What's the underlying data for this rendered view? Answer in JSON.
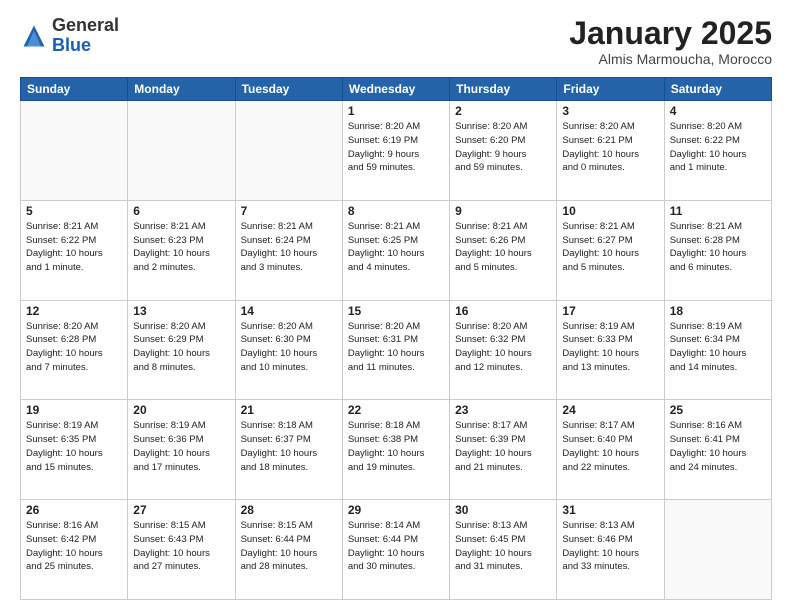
{
  "header": {
    "logo_general": "General",
    "logo_blue": "Blue",
    "month_title": "January 2025",
    "subtitle": "Almis Marmoucha, Morocco"
  },
  "weekdays": [
    "Sunday",
    "Monday",
    "Tuesday",
    "Wednesday",
    "Thursday",
    "Friday",
    "Saturday"
  ],
  "weeks": [
    [
      {
        "day": "",
        "info": "",
        "empty": true
      },
      {
        "day": "",
        "info": "",
        "empty": true
      },
      {
        "day": "",
        "info": "",
        "empty": true
      },
      {
        "day": "1",
        "info": "Sunrise: 8:20 AM\nSunset: 6:19 PM\nDaylight: 9 hours\nand 59 minutes."
      },
      {
        "day": "2",
        "info": "Sunrise: 8:20 AM\nSunset: 6:20 PM\nDaylight: 9 hours\nand 59 minutes."
      },
      {
        "day": "3",
        "info": "Sunrise: 8:20 AM\nSunset: 6:21 PM\nDaylight: 10 hours\nand 0 minutes."
      },
      {
        "day": "4",
        "info": "Sunrise: 8:20 AM\nSunset: 6:22 PM\nDaylight: 10 hours\nand 1 minute."
      }
    ],
    [
      {
        "day": "5",
        "info": "Sunrise: 8:21 AM\nSunset: 6:22 PM\nDaylight: 10 hours\nand 1 minute."
      },
      {
        "day": "6",
        "info": "Sunrise: 8:21 AM\nSunset: 6:23 PM\nDaylight: 10 hours\nand 2 minutes."
      },
      {
        "day": "7",
        "info": "Sunrise: 8:21 AM\nSunset: 6:24 PM\nDaylight: 10 hours\nand 3 minutes."
      },
      {
        "day": "8",
        "info": "Sunrise: 8:21 AM\nSunset: 6:25 PM\nDaylight: 10 hours\nand 4 minutes."
      },
      {
        "day": "9",
        "info": "Sunrise: 8:21 AM\nSunset: 6:26 PM\nDaylight: 10 hours\nand 5 minutes."
      },
      {
        "day": "10",
        "info": "Sunrise: 8:21 AM\nSunset: 6:27 PM\nDaylight: 10 hours\nand 5 minutes."
      },
      {
        "day": "11",
        "info": "Sunrise: 8:21 AM\nSunset: 6:28 PM\nDaylight: 10 hours\nand 6 minutes."
      }
    ],
    [
      {
        "day": "12",
        "info": "Sunrise: 8:20 AM\nSunset: 6:28 PM\nDaylight: 10 hours\nand 7 minutes."
      },
      {
        "day": "13",
        "info": "Sunrise: 8:20 AM\nSunset: 6:29 PM\nDaylight: 10 hours\nand 8 minutes."
      },
      {
        "day": "14",
        "info": "Sunrise: 8:20 AM\nSunset: 6:30 PM\nDaylight: 10 hours\nand 10 minutes."
      },
      {
        "day": "15",
        "info": "Sunrise: 8:20 AM\nSunset: 6:31 PM\nDaylight: 10 hours\nand 11 minutes."
      },
      {
        "day": "16",
        "info": "Sunrise: 8:20 AM\nSunset: 6:32 PM\nDaylight: 10 hours\nand 12 minutes."
      },
      {
        "day": "17",
        "info": "Sunrise: 8:19 AM\nSunset: 6:33 PM\nDaylight: 10 hours\nand 13 minutes."
      },
      {
        "day": "18",
        "info": "Sunrise: 8:19 AM\nSunset: 6:34 PM\nDaylight: 10 hours\nand 14 minutes."
      }
    ],
    [
      {
        "day": "19",
        "info": "Sunrise: 8:19 AM\nSunset: 6:35 PM\nDaylight: 10 hours\nand 15 minutes."
      },
      {
        "day": "20",
        "info": "Sunrise: 8:19 AM\nSunset: 6:36 PM\nDaylight: 10 hours\nand 17 minutes."
      },
      {
        "day": "21",
        "info": "Sunrise: 8:18 AM\nSunset: 6:37 PM\nDaylight: 10 hours\nand 18 minutes."
      },
      {
        "day": "22",
        "info": "Sunrise: 8:18 AM\nSunset: 6:38 PM\nDaylight: 10 hours\nand 19 minutes."
      },
      {
        "day": "23",
        "info": "Sunrise: 8:17 AM\nSunset: 6:39 PM\nDaylight: 10 hours\nand 21 minutes."
      },
      {
        "day": "24",
        "info": "Sunrise: 8:17 AM\nSunset: 6:40 PM\nDaylight: 10 hours\nand 22 minutes."
      },
      {
        "day": "25",
        "info": "Sunrise: 8:16 AM\nSunset: 6:41 PM\nDaylight: 10 hours\nand 24 minutes."
      }
    ],
    [
      {
        "day": "26",
        "info": "Sunrise: 8:16 AM\nSunset: 6:42 PM\nDaylight: 10 hours\nand 25 minutes."
      },
      {
        "day": "27",
        "info": "Sunrise: 8:15 AM\nSunset: 6:43 PM\nDaylight: 10 hours\nand 27 minutes."
      },
      {
        "day": "28",
        "info": "Sunrise: 8:15 AM\nSunset: 6:44 PM\nDaylight: 10 hours\nand 28 minutes."
      },
      {
        "day": "29",
        "info": "Sunrise: 8:14 AM\nSunset: 6:44 PM\nDaylight: 10 hours\nand 30 minutes."
      },
      {
        "day": "30",
        "info": "Sunrise: 8:13 AM\nSunset: 6:45 PM\nDaylight: 10 hours\nand 31 minutes."
      },
      {
        "day": "31",
        "info": "Sunrise: 8:13 AM\nSunset: 6:46 PM\nDaylight: 10 hours\nand 33 minutes."
      },
      {
        "day": "",
        "info": "",
        "empty": true
      }
    ]
  ]
}
